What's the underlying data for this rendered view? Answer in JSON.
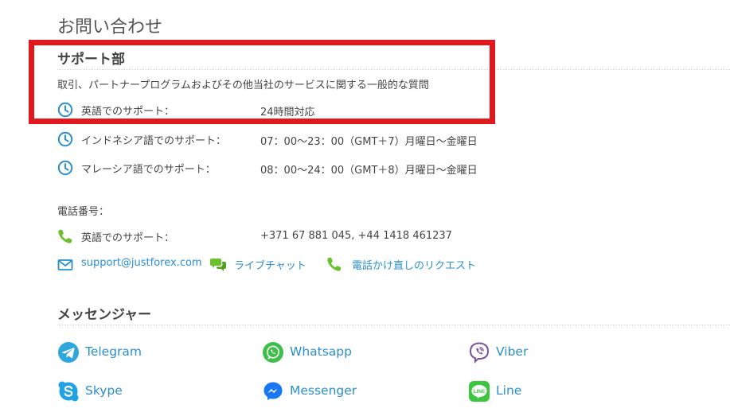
{
  "page": {
    "title": "お問い合わせ"
  },
  "support": {
    "title": "サポート部",
    "description": "取引、パートナープログラムおよびその他当社のサービスに関する一般的な質問",
    "hours": [
      {
        "label": "英語でのサポート：",
        "value": "24時間対応"
      },
      {
        "label": "インドネシア語でのサポート：",
        "value": "07：00〜23：00（GMT＋7）月曜日〜金曜日"
      },
      {
        "label": "マレーシア語でのサポート：",
        "value": "08：00〜24：00（GMT＋8）月曜日〜金曜日"
      }
    ],
    "phone_heading": "電話番号：",
    "phone": {
      "label": "英語でのサポート：",
      "value": "+371 67 881 045, +44 1418 461237"
    },
    "links": {
      "email": "support@justforex.com",
      "live_chat": "ライブチャット",
      "callback": "電話かけ直しのリクエスト"
    }
  },
  "messengers": {
    "title": "メッセンジャー",
    "items": [
      {
        "name": "Telegram",
        "icon": "telegram-icon"
      },
      {
        "name": "Whatsapp",
        "icon": "whatsapp-icon"
      },
      {
        "name": "Viber",
        "icon": "viber-icon"
      },
      {
        "name": "Skype",
        "icon": "skype-icon"
      },
      {
        "name": "Messenger",
        "icon": "messenger-icon"
      },
      {
        "name": "Line",
        "icon": "line-icon"
      }
    ]
  },
  "colors": {
    "accent_blue": "#2a8fcf",
    "phone_green": "#6cbf2e",
    "highlight_red": "#e3181f"
  }
}
